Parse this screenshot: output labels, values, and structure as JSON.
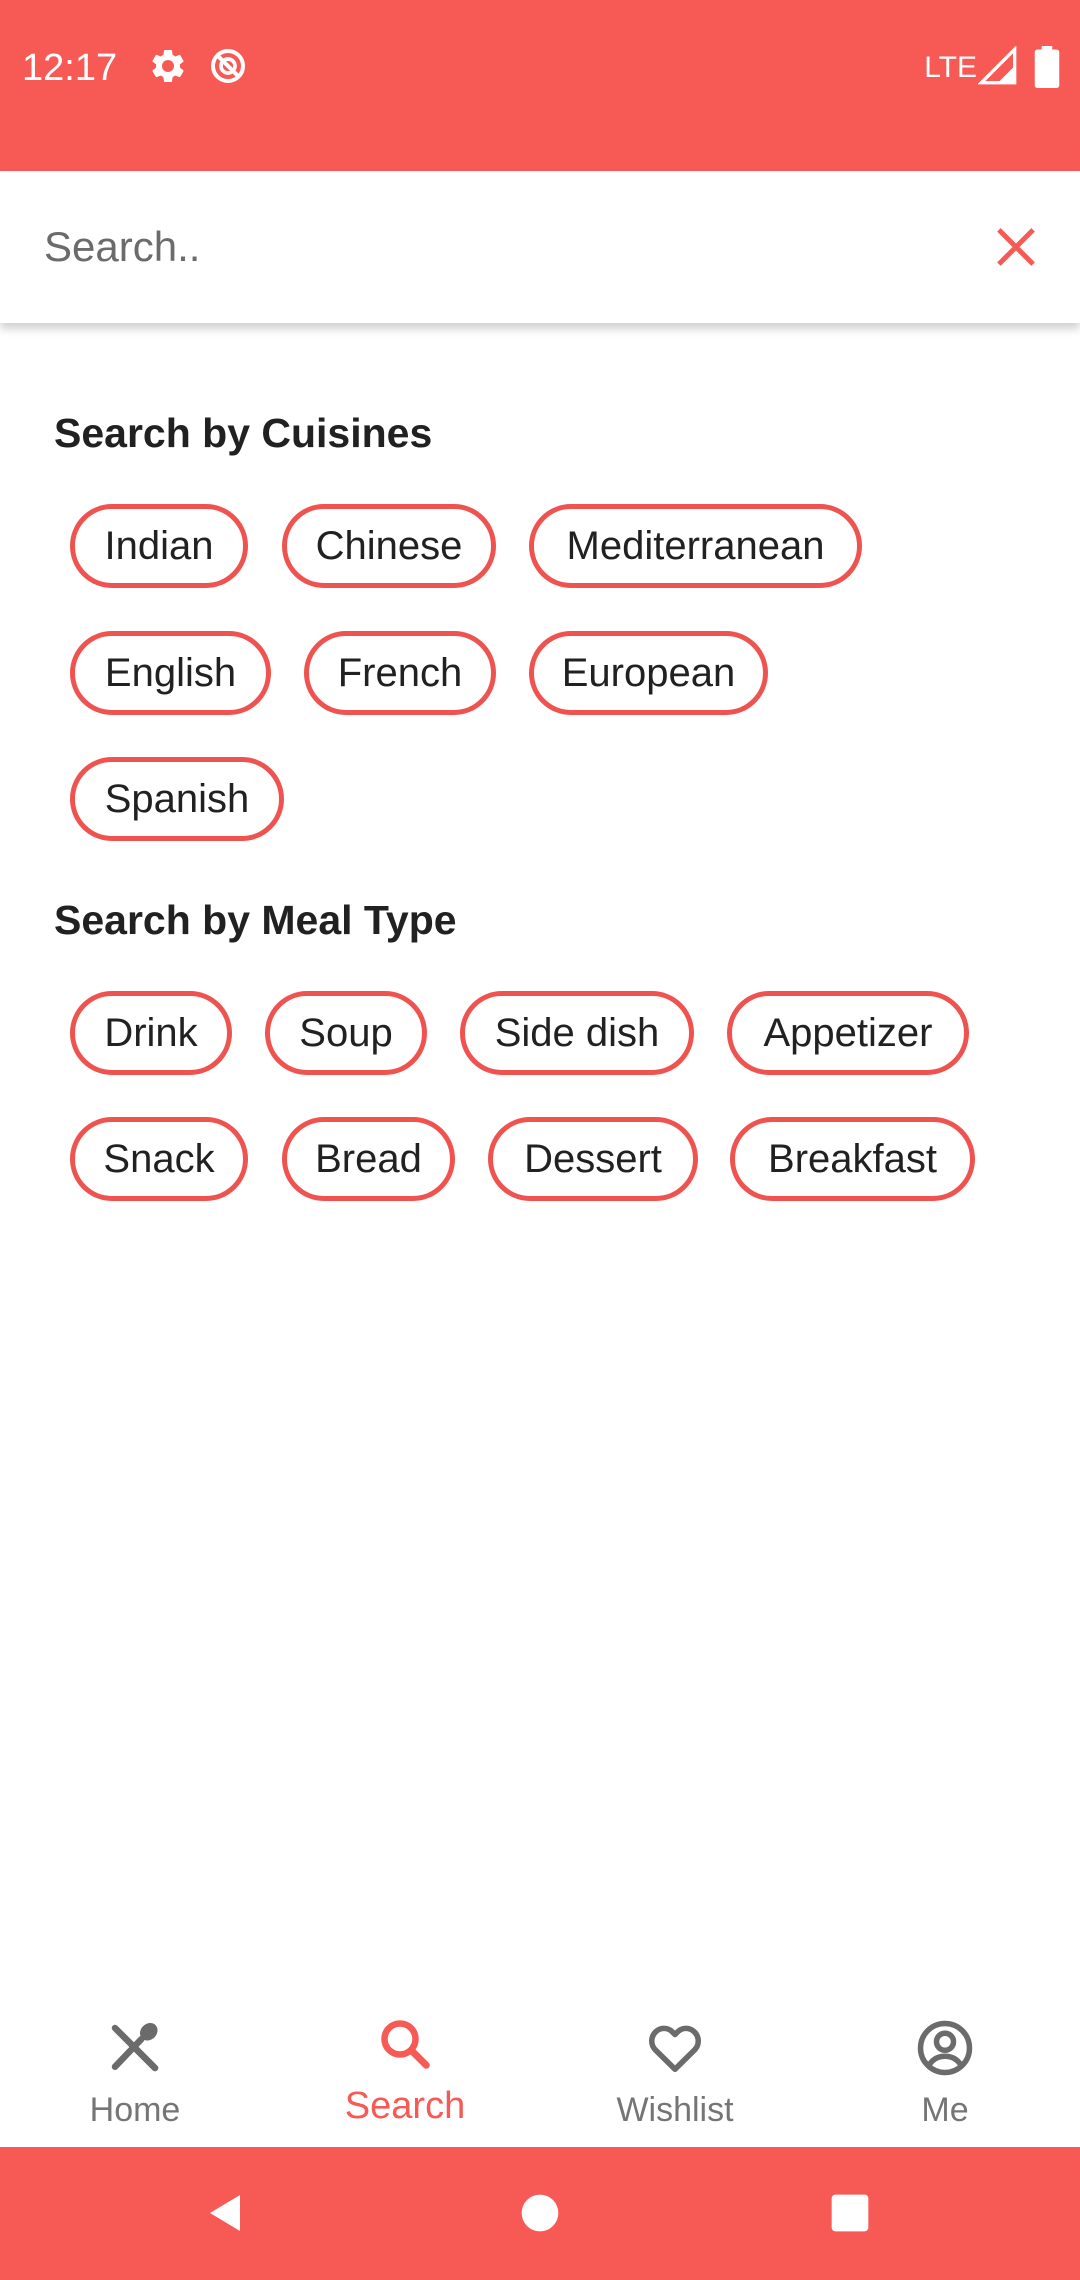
{
  "status_bar": {
    "time": "12:17",
    "network": "LTE",
    "icons": [
      "settings-icon",
      "do-not-disturb-icon",
      "signal-icon",
      "battery-icon"
    ]
  },
  "search": {
    "placeholder": "Search..",
    "value": ""
  },
  "cuisines": {
    "title": "Search by Cuisines",
    "chips": [
      "Indian",
      "Chinese",
      "Mediterranean",
      "English",
      "French",
      "European",
      "Spanish"
    ]
  },
  "meal_types": {
    "title": "Search by Meal Type",
    "chips": [
      "Drink",
      "Soup",
      "Side dish",
      "Appetizer",
      "Snack",
      "Bread",
      "Dessert",
      "Breakfast"
    ]
  },
  "bottom_nav": {
    "items": [
      {
        "label": "Home",
        "icon": "utensils-icon",
        "active": false
      },
      {
        "label": "Search",
        "icon": "search-icon",
        "active": true
      },
      {
        "label": "Wishlist",
        "icon": "heart-icon",
        "active": false
      },
      {
        "label": "Me",
        "icon": "account-icon",
        "active": false
      }
    ]
  },
  "colors": {
    "accent": "#f75a55",
    "chip_border": "#ef5350",
    "text": "#212121",
    "muted": "#757575"
  }
}
